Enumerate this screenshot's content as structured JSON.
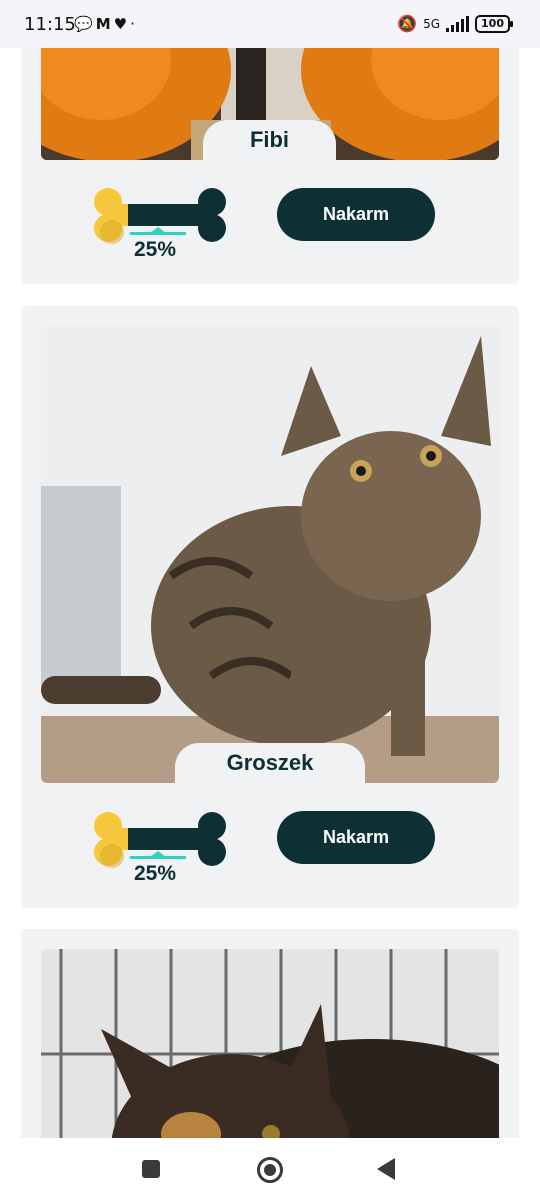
{
  "status_bar": {
    "time": "11:15",
    "notification_icons": [
      "chat-icon",
      "mcdonalds-icon",
      "heart-icon",
      "dot-icon"
    ],
    "network": "5G",
    "battery": "100"
  },
  "cats": [
    {
      "name": "Fibi",
      "percent": "25%",
      "fill_fraction": 0.25,
      "button": "Nakarm"
    },
    {
      "name": "Groszek",
      "percent": "25%",
      "fill_fraction": 0.25,
      "button": "Nakarm"
    },
    {
      "name": "",
      "percent": "",
      "button": ""
    }
  ],
  "colors": {
    "accent": "#0d3034",
    "bone_fill": "#f6c63b",
    "indicator": "#2ed3c2",
    "card_bg": "#f1f2f3"
  },
  "nav": [
    "recents-button",
    "home-button",
    "back-button"
  ]
}
